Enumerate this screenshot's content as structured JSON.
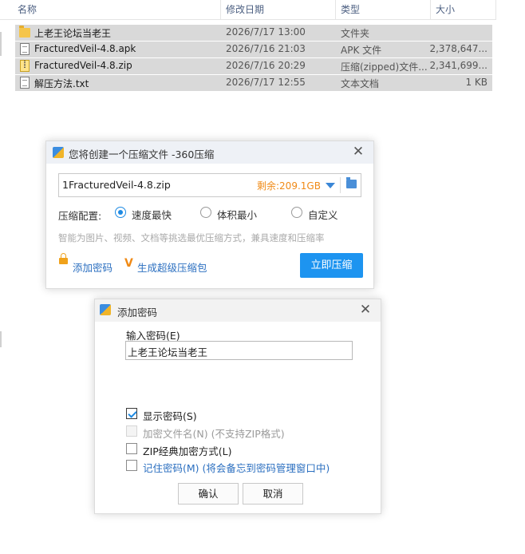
{
  "explorer": {
    "columns": [
      "名称",
      "修改日期",
      "类型",
      "大小"
    ],
    "files": [
      {
        "icon": "folder-icon",
        "name": "上老王论坛当老王",
        "date": "2026/7/17 13:00",
        "type": "文件夹",
        "size": ""
      },
      {
        "icon": "document-icon",
        "name": "FracturedVeil-4.8.apk",
        "date": "2026/7/16 21:03",
        "type": "APK 文件",
        "size": "2,378,647..."
      },
      {
        "icon": "zip-icon",
        "name": "FracturedVeil-4.8.zip",
        "date": "2026/7/16 20:29",
        "type": "压缩(zipped)文件...",
        "size": "2,341,699..."
      },
      {
        "icon": "document-icon",
        "name": "解压方法.txt",
        "date": "2026/7/17 12:55",
        "type": "文本文档",
        "size": "1 KB"
      }
    ]
  },
  "compress_dialog": {
    "title": "您将创建一个压缩文件 -360压缩",
    "path": "1FracturedVeil-4.8.zip",
    "free_space": "剩余:209.1GB",
    "config_label": "压缩配置:",
    "options": [
      {
        "label": "速度最快",
        "selected": true
      },
      {
        "label": "体积最小",
        "selected": false
      },
      {
        "label": "自定义",
        "selected": false
      }
    ],
    "hint": "智能为图片、视频、文档等挑选最优压缩方式，兼具速度和压缩率",
    "add_password": "添加密码",
    "super_package": "生成超级压缩包",
    "compress_now": "立即压缩",
    "accent_color": "#1d94f0"
  },
  "password_dialog": {
    "title": "添加密码",
    "label": "输入密码(E)",
    "password_value": "上老王论坛当老王",
    "checkboxes": [
      {
        "label": "显示密码(S)",
        "checked": true,
        "disabled": false
      },
      {
        "label": "加密文件名(N) (不支持ZIP格式)",
        "checked": false,
        "disabled": true
      },
      {
        "label": "ZIP经典加密方式(L)",
        "checked": false,
        "disabled": false
      },
      {
        "label": "记住密码(M) (将会备忘到密码管理窗口中)",
        "checked": false,
        "disabled": false
      }
    ],
    "ok": "确认",
    "cancel": "取消"
  }
}
